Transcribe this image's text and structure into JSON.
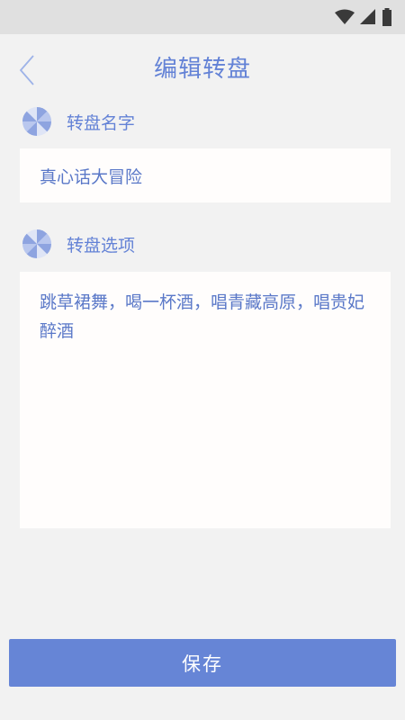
{
  "status_bar": {
    "icons": [
      "wifi-icon",
      "cellular-signal-icon",
      "battery-icon"
    ]
  },
  "header": {
    "back_icon": "chevron-left-icon",
    "title": "编辑转盘"
  },
  "name_section": {
    "icon": "wheel-icon",
    "label": "转盘名字",
    "value": "真心话大冒险"
  },
  "options_section": {
    "icon": "wheel-icon",
    "label": "转盘选项",
    "value": "跳草裙舞，喝一杯酒，唱青藏高原，唱贵妃醉酒"
  },
  "save_button": {
    "label": "保存"
  },
  "colors": {
    "accent": "#6382d6",
    "button": "#6685d6",
    "background": "#f2f2f2",
    "status_bar": "#e0e0e0",
    "field_background": "#fffdfc"
  }
}
